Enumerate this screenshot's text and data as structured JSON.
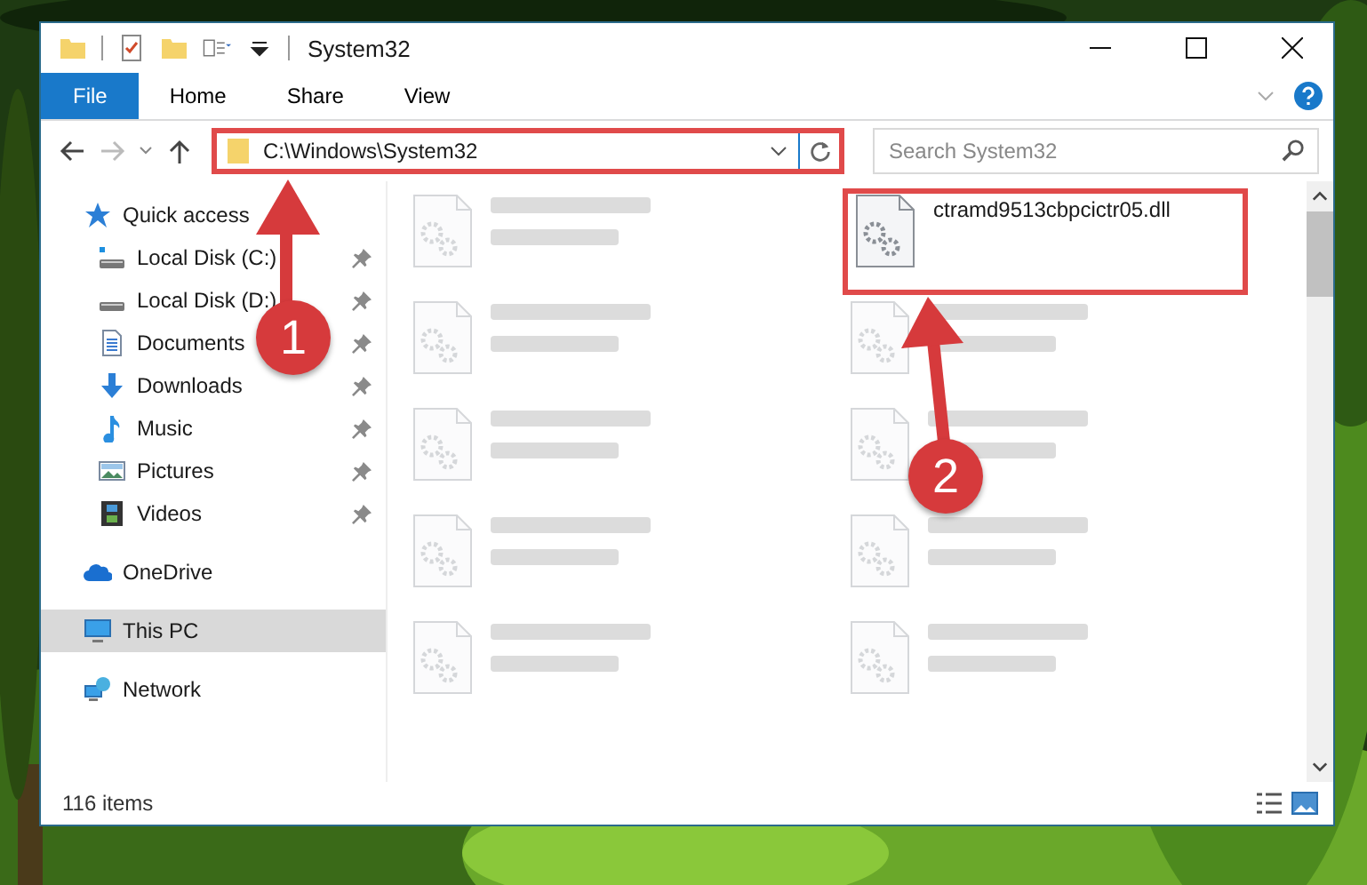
{
  "window": {
    "title": "System32"
  },
  "ribbon": {
    "tabs": [
      {
        "label": "File",
        "selected": true
      },
      {
        "label": "Home",
        "selected": false
      },
      {
        "label": "Share",
        "selected": false
      },
      {
        "label": "View",
        "selected": false
      }
    ]
  },
  "address_bar": {
    "path": "C:\\Windows\\System32",
    "outlined": true
  },
  "search": {
    "placeholder": "Search System32"
  },
  "sidebar": {
    "items": [
      {
        "label": "Quick access",
        "kind": "quick",
        "selected": false,
        "children": [
          {
            "label": "Local Disk (C:)",
            "kind": "system-drive",
            "pinned": true
          },
          {
            "label": "Local Disk (D:)",
            "kind": "drive",
            "pinned": true
          },
          {
            "label": "Documents",
            "kind": "documents",
            "pinned": true
          },
          {
            "label": "Downloads",
            "kind": "downloads",
            "pinned": true
          },
          {
            "label": "Music",
            "kind": "music",
            "pinned": true
          },
          {
            "label": "Pictures",
            "kind": "pictures",
            "pinned": true
          },
          {
            "label": "Videos",
            "kind": "videos",
            "pinned": true
          }
        ]
      },
      {
        "label": "OneDrive",
        "kind": "cloud",
        "selected": false
      },
      {
        "label": "This PC",
        "kind": "pc",
        "selected": true
      },
      {
        "label": "Network",
        "kind": "network",
        "selected": false
      }
    ]
  },
  "files": [
    {
      "kind": "blurred"
    },
    {
      "kind": "file",
      "name": "ctramd9513cbpcictr05.dll",
      "outlined": true
    },
    {
      "kind": "blurred"
    },
    {
      "kind": "blurred"
    },
    {
      "kind": "blurred"
    },
    {
      "kind": "blurred"
    },
    {
      "kind": "blurred"
    },
    {
      "kind": "blurred"
    },
    {
      "kind": "blurred"
    },
    {
      "kind": "blurred"
    }
  ],
  "status_bar": {
    "item_count": "116 items"
  },
  "annotations": [
    {
      "number": "1"
    },
    {
      "number": "2"
    }
  ]
}
